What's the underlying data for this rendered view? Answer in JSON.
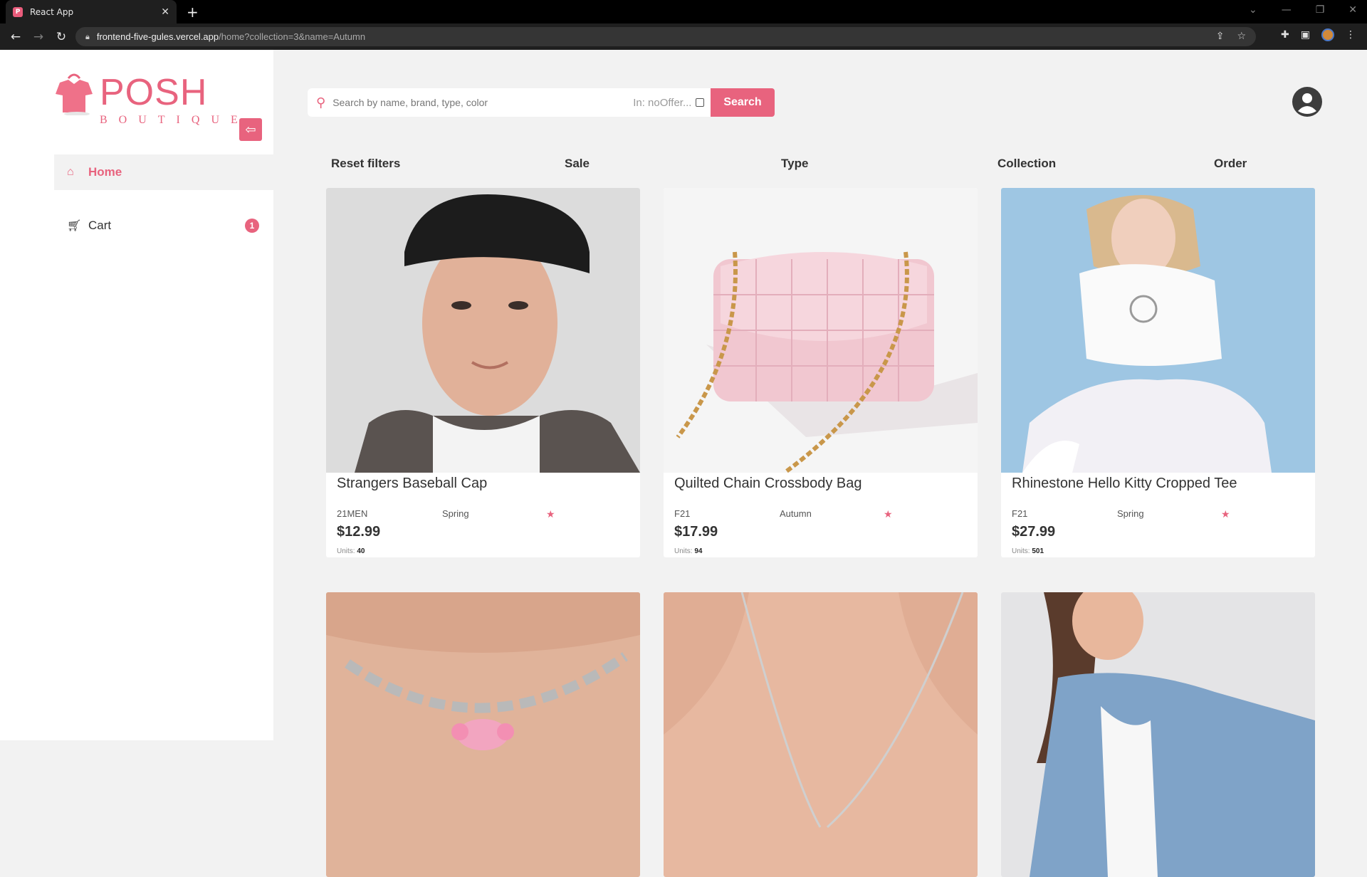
{
  "browser": {
    "tab_title": "React App",
    "tab_close": "✕",
    "new_tab": "+",
    "url_host": "frontend-five-gules.vercel.app",
    "url_path": "/home?collection=3&name=Autumn",
    "window_controls": [
      "⌄",
      "—",
      "❐",
      "✕"
    ]
  },
  "brand": {
    "name": "POSH",
    "subtitle": "BOUTIQUE",
    "accent_color": "#e8637e"
  },
  "sidebar": {
    "items": [
      {
        "label": "Home",
        "icon": "home-icon",
        "active": true
      },
      {
        "label": "Cart",
        "icon": "cart-icon",
        "badge": "1"
      }
    ]
  },
  "search": {
    "placeholder": "Search by name, brand, type, color",
    "offer_label": "In: noOffer...",
    "button_label": "Search"
  },
  "filters": [
    "Reset filters",
    "Sale",
    "Type",
    "Collection",
    "Order"
  ],
  "products": [
    {
      "name": "Strangers Baseball Cap",
      "brand": "21MEN",
      "season": "Spring",
      "price": "$12.99",
      "units_label": "Units:",
      "units": "40"
    },
    {
      "name": "Quilted Chain Crossbody Bag",
      "brand": "F21",
      "season": "Autumn",
      "price": "$17.99",
      "units_label": "Units:",
      "units": "94"
    },
    {
      "name": "Rhinestone Hello Kitty Cropped Tee",
      "brand": "F21",
      "season": "Spring",
      "price": "$27.99",
      "units_label": "Units:",
      "units": "501"
    }
  ]
}
